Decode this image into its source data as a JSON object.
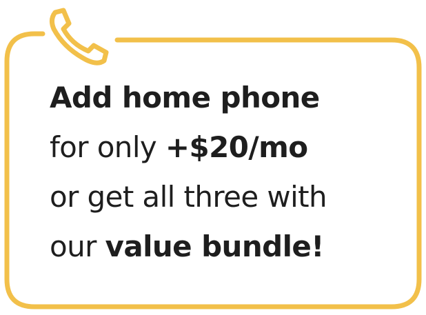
{
  "colors": {
    "accent": "#F2C04A",
    "text": "#1E1E1E",
    "background": "#FFFFFF"
  },
  "icon": "phone-icon",
  "promo": {
    "line1_bold": "Add home phone",
    "line2_regular": "for only ",
    "line2_bold": "+$20/mo",
    "line3_regular": "or get all three with",
    "line4_regular": "our ",
    "line4_bold": "value bundle!"
  }
}
